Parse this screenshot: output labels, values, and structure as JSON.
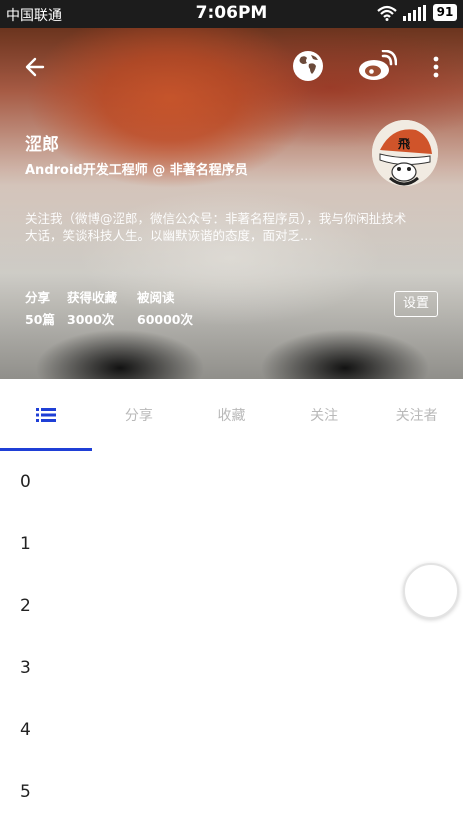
{
  "status_bar": {
    "carrier": "中国联通",
    "time": "7:06PM",
    "battery": "91"
  },
  "header": {
    "icons": [
      "back-arrow-icon",
      "globe-icon",
      "weibo-icon",
      "more-vertical-icon"
    ],
    "name": "涩郎",
    "job_title": "Android开发工程师 @ 非著名程序员",
    "bio": "关注我（微博@涩郎，微信公众号：非著名程序员），我与你闲扯技术大话，笑谈科技人生。以幽默诙谐的态度，面对乏…",
    "stats": {
      "labels": [
        "分享",
        "获得收藏",
        "被阅读"
      ],
      "values": [
        "50篇",
        "3000次",
        "60000次"
      ]
    },
    "settings_label": "设置",
    "avatar_text": "飛"
  },
  "tabs": {
    "items": [
      {
        "icon": "list-icon",
        "active": true
      },
      {
        "label": "分享"
      },
      {
        "label": "收藏"
      },
      {
        "label": "关注"
      },
      {
        "label": "关注者"
      }
    ],
    "accent_color": "#1f3fd6"
  },
  "list": {
    "items": [
      "0",
      "1",
      "2",
      "3",
      "4",
      "5"
    ]
  }
}
